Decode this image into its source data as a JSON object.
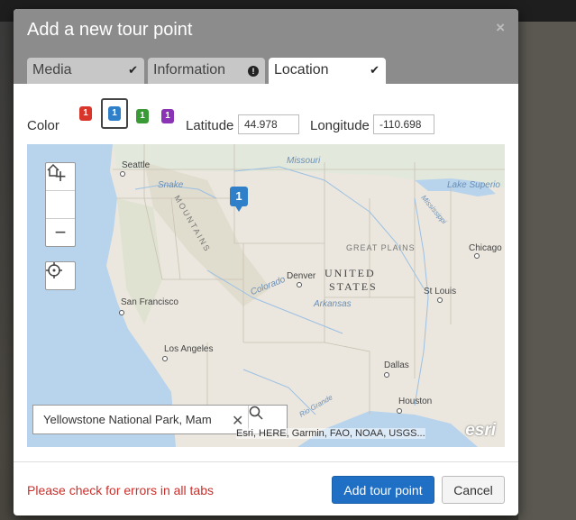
{
  "dialog": {
    "title": "Add a new tour point",
    "close_glyph": "×"
  },
  "tabs": [
    {
      "label": "Media",
      "status_icon": "checkmark-icon",
      "glyph": "✔"
    },
    {
      "label": "Information",
      "status_icon": "error-icon",
      "glyph": "!"
    },
    {
      "label": "Location",
      "status_icon": "checkmark-icon",
      "glyph": "✔",
      "active": true
    }
  ],
  "location": {
    "color_label": "Color",
    "pins": [
      {
        "number": "1",
        "color": "#d8352b"
      },
      {
        "number": "1",
        "color": "#2f7fc9",
        "selected": true
      },
      {
        "number": "1",
        "color": "#3a9a35"
      },
      {
        "number": "1",
        "color": "#8a33b5"
      }
    ],
    "latitude_label": "Latitude",
    "latitude_value": "44.978",
    "longitude_label": "Longitude",
    "longitude_value": "-110.698"
  },
  "map": {
    "zoom_in": "+",
    "zoom_out": "−",
    "marker_number": "1",
    "search_value": "Yellowstone National Park, Mam",
    "attribution": "Esri, HERE, Garmin, FAO, NOAA, USGS...",
    "logo": "esri",
    "labels": {
      "seattle": "Seattle",
      "missouri": "Missouri",
      "snake": "Snake",
      "lake_superior": "Lake Superio",
      "mississippi": "Mississippi",
      "great_plains": "GREAT PLAINS",
      "chicago": "Chicago",
      "denver": "Denver",
      "united": "UNITED",
      "states": "STATES",
      "colorado": "Colorado",
      "arkansas": "Arkansas",
      "st_louis": "St Louis",
      "san_francisco": "San Francisco",
      "los_angeles": "Los Angeles",
      "dallas": "Dallas",
      "houston": "Houston",
      "rio_grande": "Rio Grande",
      "mountains": "MOUNTAINS"
    }
  },
  "footer": {
    "error_message": "Please check for errors in all tabs",
    "add_button": "Add tour point",
    "cancel_button": "Cancel"
  }
}
